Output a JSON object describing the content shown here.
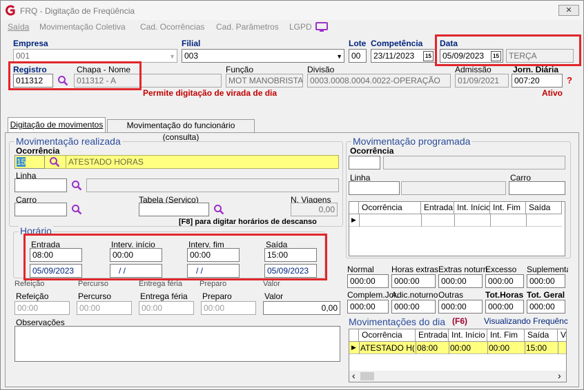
{
  "window": {
    "title": "FRQ - Digitação de Freqüência",
    "close_glyph": "✕"
  },
  "menu": [
    "Saída",
    "Movimentação Coletiva",
    "Cad. Ocorrências",
    "Cad. Parâmetros",
    "LGPD"
  ],
  "header": {
    "empresa_label": "Empresa",
    "empresa_value": "001",
    "filial_label": "Filial",
    "filial_value": "003",
    "lote_label": "Lote",
    "lote_value": "00",
    "competencia_label": "Competência",
    "competencia_value": "23/11/2023",
    "data_label": "Data",
    "data_value": "05/09/2023",
    "dia_semana": "TERÇA",
    "cal_glyph": "15",
    "registro_label": "Registro",
    "registro_value": "011312",
    "chapa_label": "Chapa - Nome",
    "chapa_value": "011312 - A",
    "funcao_label": "Função",
    "funcao_value": "MOT MANOBRISTA",
    "divisao_label": "Divisão",
    "divisao_value": "0003.0008.0004.0022-OPERAÇÃO",
    "admissao_label": "Admissão",
    "admissao_value": "01/09/2021",
    "jorn_label": "Jorn. Diária",
    "jorn_value": "007:20",
    "help_glyph": "?",
    "virada_msg": "Permite digitação de virada de dia",
    "status": "Ativo"
  },
  "tabs": [
    "Digitação de movimentos",
    "Movimentação do funcionário (consulta)"
  ],
  "realizada": {
    "title": "Movimentação realizada",
    "ocorrencia_label": "Ocorrência",
    "ocorrencia_code": "15",
    "ocorrencia_desc": "ATESTADO HORAS",
    "linha_label": "Linha",
    "carro_label": "Carro",
    "tabela_label": "Tabela (Serviço)",
    "viagens_label": "N. Viagens",
    "viagens_value": "0,00",
    "f8_hint": "[F8] para digitar horários de descanso"
  },
  "horario": {
    "title": "Horário",
    "entrada_label": "Entrada",
    "entrada_value": "08:00",
    "entrada_data": "05/09/2023",
    "inicio_label": "Interv. início",
    "inicio_value": "00:00",
    "inicio_data": "/ /",
    "fim_label": "Interv. fim",
    "fim_value": "00:00",
    "fim_data": "/ /",
    "saida_label": "Saída",
    "saida_value": "15:00",
    "saida_data": "05/09/2023"
  },
  "ghost_labels": [
    "Refeição",
    "Percurso",
    "Entrega féria",
    "Preparo",
    "Valor"
  ],
  "extras": {
    "refeicao_label": "Refeição",
    "refeicao_value": "00:00",
    "percurso_label": "Percurso",
    "percurso_value": "00:00",
    "entrega_label": "Entrega féria",
    "entrega_value": "00:00",
    "preparo_label": "Preparo",
    "preparo_value": "00:00",
    "valor_label": "Valor",
    "valor_value": "0,00",
    "obs_label": "Observações"
  },
  "programada": {
    "title": "Movimentação programada",
    "ocorrencia_label": "Ocorrência",
    "linha_label": "Linha",
    "carro_label": "Carro",
    "grid_headers": [
      "Ocorrência",
      "Entrada",
      "Int. Início",
      "Int. Fim",
      "Saída"
    ]
  },
  "totais": {
    "row1_labels": [
      "Normal",
      "Horas extras",
      "Extras noturn.",
      "Excesso",
      "Suplementar"
    ],
    "row1_values": [
      "000:00",
      "000:00",
      "000:00",
      "000:00",
      "000:00"
    ],
    "row2_labels": [
      "Complem.Jor.",
      "Adic.noturno",
      "Outras",
      "Tot.Horas",
      "Tot. Geral"
    ],
    "row2_values": [
      "000:00",
      "000:00",
      "000:00",
      "000:00",
      "000:00"
    ]
  },
  "dia": {
    "title": "Movimentações do dia",
    "f6": "(F6)",
    "visualizando": "Visualizando Frequência",
    "headers": [
      "Ocorrência",
      "Entrada",
      "Int. Início",
      "Int. Fim",
      "Saída",
      "Va"
    ],
    "row": [
      "ATESTADO H(",
      "08:00",
      "00:00",
      "00:00",
      "15:00",
      ""
    ],
    "scroll_left": "‹",
    "scroll_right": "›"
  },
  "colors": {
    "highlight": "#ffff80",
    "red_box": "#e0262b",
    "label_blue": "#00247d",
    "group_title": "#2a4c9c"
  }
}
